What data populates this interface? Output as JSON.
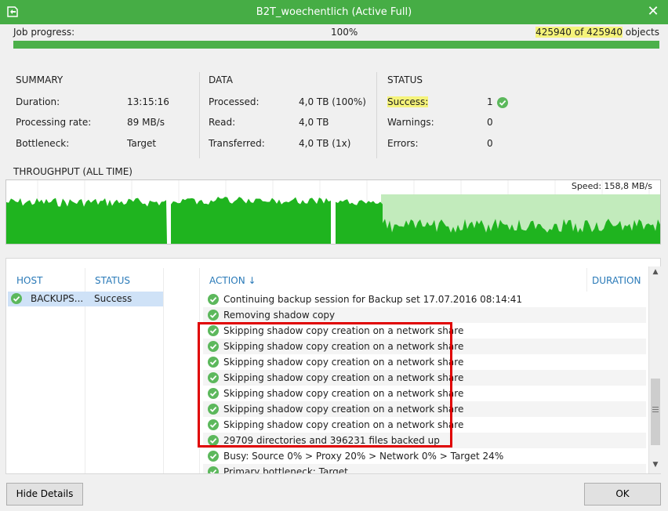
{
  "window": {
    "title": "B2T_woechentlich (Active Full)"
  },
  "progress": {
    "label": "Job progress:",
    "percent_text": "100%",
    "percent": 1.0,
    "objects_done": "425940",
    "objects_of": " of ",
    "objects_total": "425940",
    "objects_suffix": " objects"
  },
  "summary": {
    "heading": "SUMMARY",
    "rows": [
      {
        "label": "Duration:",
        "value": "13:15:16"
      },
      {
        "label": "Processing rate:",
        "value": "89 MB/s"
      },
      {
        "label": "Bottleneck:",
        "value": "Target"
      }
    ]
  },
  "data_section": {
    "heading": "DATA",
    "rows": [
      {
        "label": "Processed:",
        "value": "4,0 TB (100%)"
      },
      {
        "label": "Read:",
        "value": "4,0 TB"
      },
      {
        "label": "Transferred:",
        "value": "4,0 TB (1x)"
      }
    ]
  },
  "status_section": {
    "heading": "STATUS",
    "rows": [
      {
        "label": "Success:",
        "value": "1"
      },
      {
        "label": "Warnings:",
        "value": "0"
      },
      {
        "label": "Errors:",
        "value": "0"
      }
    ]
  },
  "throughput": {
    "label": "THROUGHPUT (ALL TIME)",
    "speed": "Speed: 158,8 MB/s",
    "colors": {
      "fill": "#1fb41f",
      "bg": "#c2ebbc"
    }
  },
  "details": {
    "host_header": "HOST",
    "status_header": "STATUS",
    "action_header": "ACTION",
    "sort_arrow": "↓",
    "duration_header": "DURATION",
    "hosts": [
      {
        "name": "BACKUPS...",
        "status": "Success",
        "icon": "success-check-icon"
      }
    ],
    "log": [
      "Continuing backup session for Backup set 17.07.2016 08:14:41",
      "Removing shadow copy",
      "Skipping shadow copy creation on a network share",
      "Skipping shadow copy creation on a network share",
      "Skipping shadow copy creation on a network share",
      "Skipping shadow copy creation on a network share",
      "Skipping shadow copy creation on a network share",
      "Skipping shadow copy creation on a network share",
      "Skipping shadow copy creation on a network share",
      "29709 directories and 396231 files backed up",
      "Busy: Source 0% > Proxy 20% > Network 0% > Target 24%",
      "Primary bottleneck: Target"
    ]
  },
  "buttons": {
    "hide_details": "Hide Details",
    "ok": "OK"
  },
  "colors": {
    "accent": "#46ad45",
    "link": "#2a7ab8",
    "highlight": "#f5f37a",
    "annotation": "#e00000"
  }
}
